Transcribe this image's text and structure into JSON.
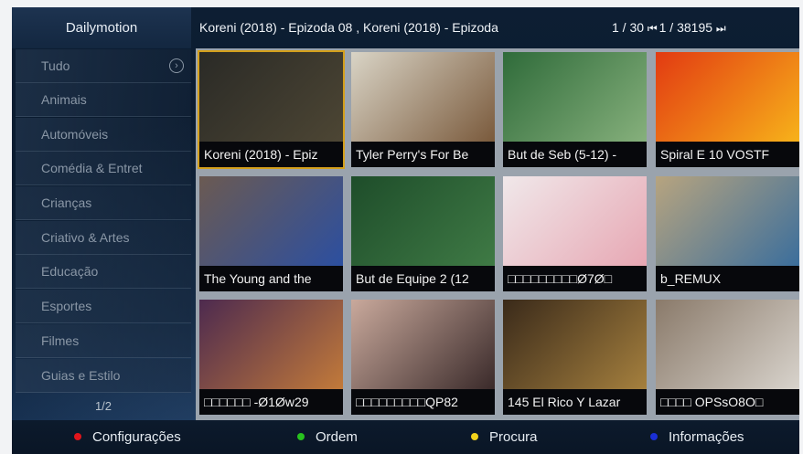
{
  "header": {
    "app_title": "Dailymotion",
    "now_playing": "Koreni (2018) - Epizoda 08 , Koreni (2018) - Epizoda",
    "page_prefix": "1 / 30",
    "skip_back_glyph": "⏮",
    "items_count": "1 / 38195",
    "skip_forward_glyph": "⏭"
  },
  "sidebar": {
    "items": [
      {
        "label": "Tudo",
        "icon": "chevron-right-circle-icon",
        "glyph": "›"
      },
      {
        "label": "Animais"
      },
      {
        "label": "Automóveis"
      },
      {
        "label": "Comédia & Entret"
      },
      {
        "label": "Crianças"
      },
      {
        "label": "Criativo & Artes"
      },
      {
        "label": "Educação"
      },
      {
        "label": "Esportes"
      },
      {
        "label": "Filmes"
      },
      {
        "label": "Guias e Estilo"
      }
    ],
    "page": "1/2"
  },
  "videos": [
    {
      "title": "Koreni (2018) - Epiz",
      "colors": [
        "#2a2a26",
        "#4d4634"
      ],
      "selected": true
    },
    {
      "title": "Tyler Perry's For Be",
      "colors": [
        "#d9d4c6",
        "#7a5a3c"
      ]
    },
    {
      "title": "But de Seb (5-12) -",
      "colors": [
        "#2f6b3a",
        "#86b07c"
      ]
    },
    {
      "title": "Spiral E 10 VOSTF",
      "colors": [
        "#e23a12",
        "#f7b21a"
      ]
    },
    {
      "title": "The Young and the",
      "colors": [
        "#6b5a52",
        "#2c4fa0"
      ]
    },
    {
      "title": "But de Equipe 2 (12",
      "colors": [
        "#1e4d2a",
        "#3f7a45"
      ]
    },
    {
      "title": "□□□□□□□□□Ø7Ø□",
      "colors": [
        "#f0e8ea",
        "#e7a7b3"
      ]
    },
    {
      "title": "b_REMUX",
      "colors": [
        "#b7a47f",
        "#3b6e9c"
      ]
    },
    {
      "title": "□□□□□□ -Ø1Øw29",
      "colors": [
        "#4d2a4f",
        "#c27a3a"
      ]
    },
    {
      "title": "□□□□□□□□□QP82",
      "colors": [
        "#c9a99c",
        "#3a2a2a"
      ]
    },
    {
      "title": "145 El Rico Y Lazar",
      "colors": [
        "#3a2a1a",
        "#a5803e"
      ]
    },
    {
      "title": "□□□□ OPSsO8O□",
      "colors": [
        "#8a7a6a",
        "#d8d3cc"
      ]
    }
  ],
  "footer": {
    "keys": [
      {
        "label": "Configurações",
        "color": "#e0151b"
      },
      {
        "label": "Ordem",
        "color": "#27c21e"
      },
      {
        "label": "Procura",
        "color": "#f1d21c"
      },
      {
        "label": "Informações",
        "color": "#1a2fd6"
      }
    ]
  }
}
